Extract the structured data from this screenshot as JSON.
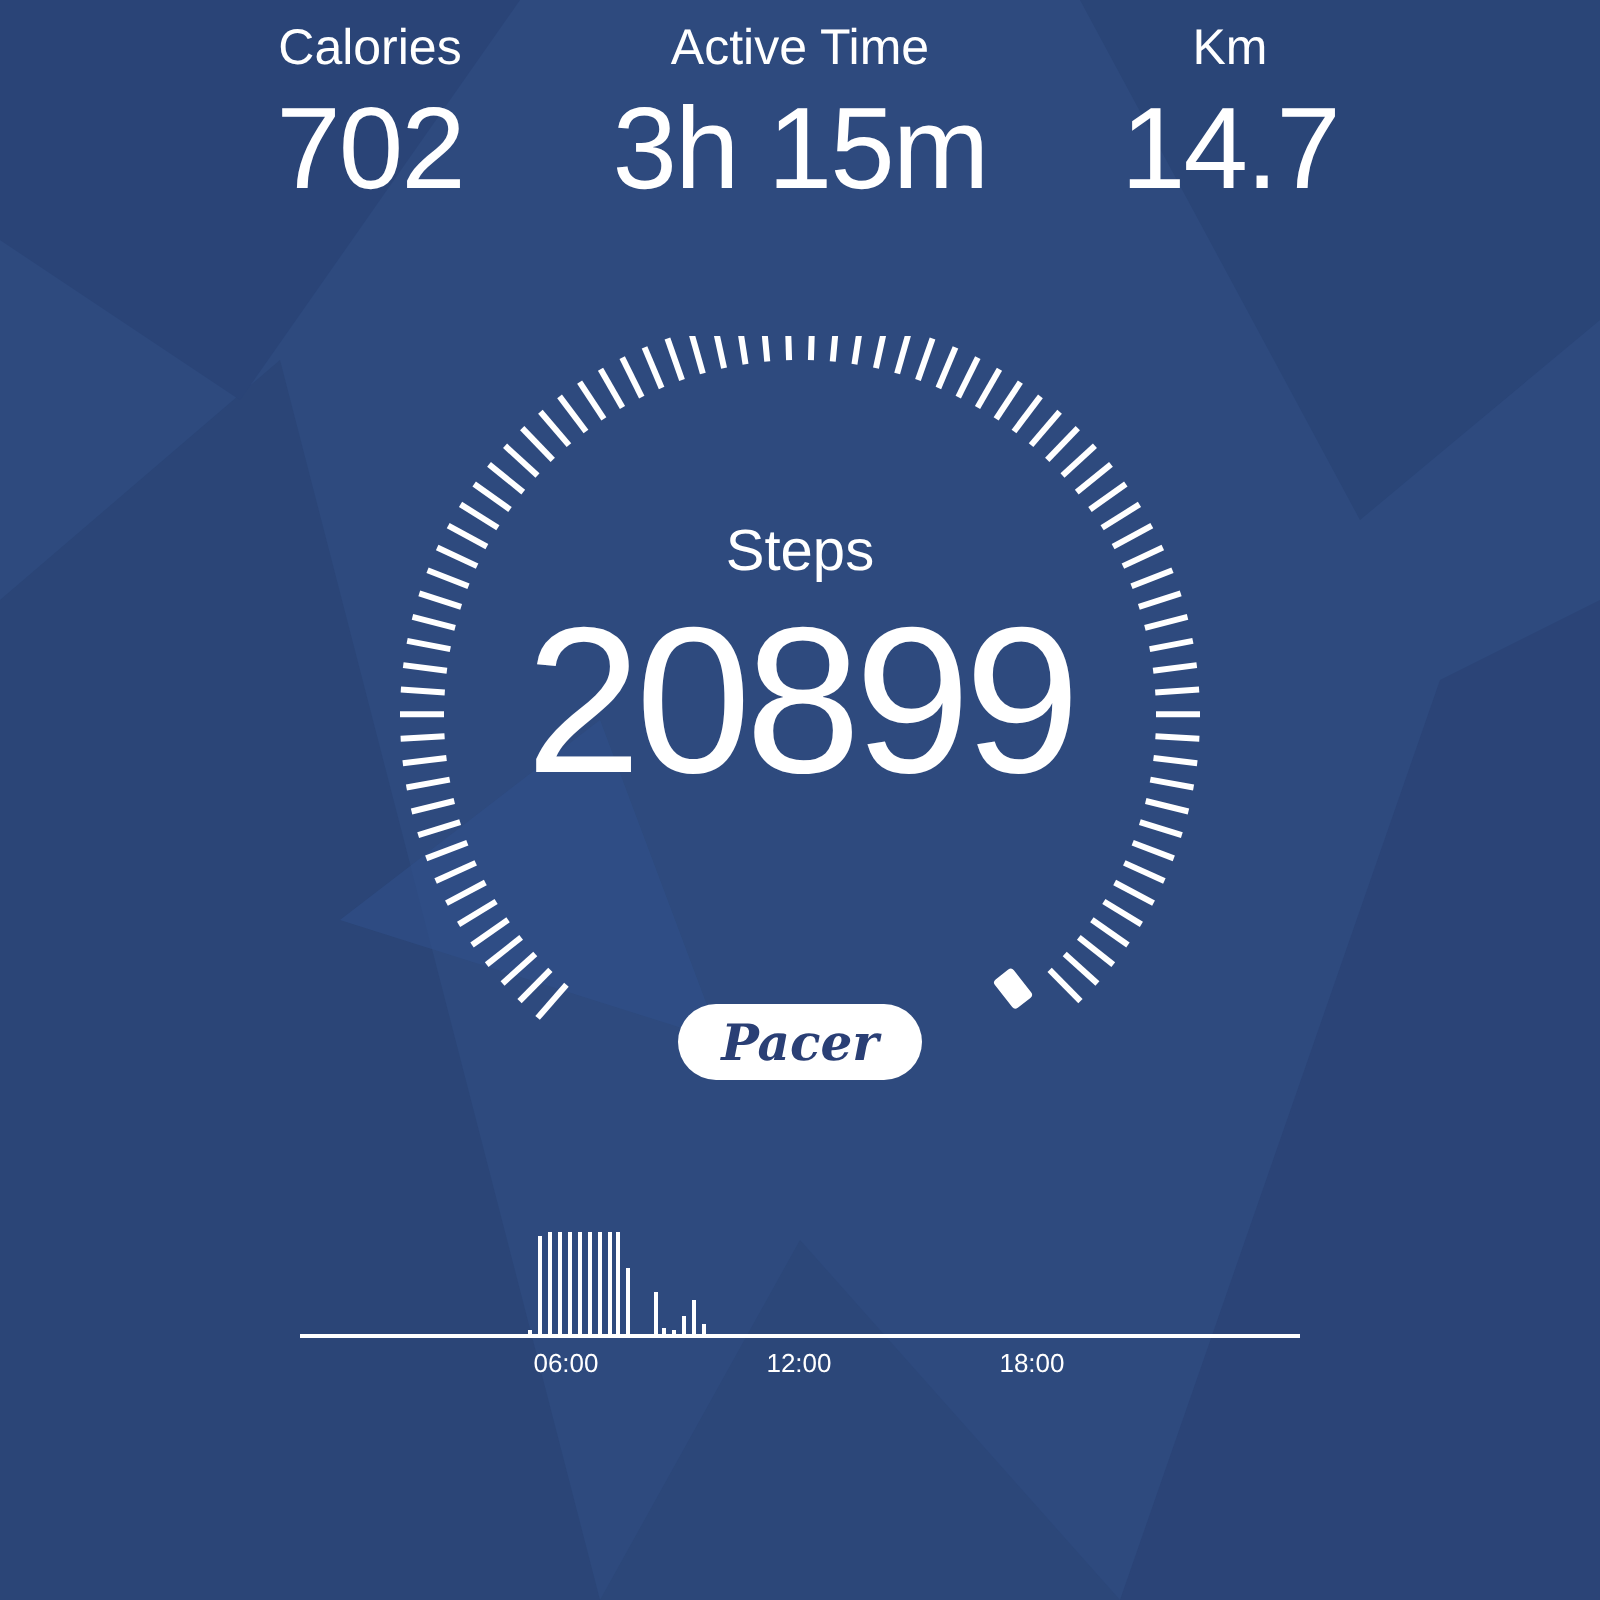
{
  "stats": [
    {
      "label": "Calories",
      "value": "702"
    },
    {
      "label": "Active Time",
      "value": "3h 15m"
    },
    {
      "label": "Km",
      "value": "14.7"
    }
  ],
  "gauge": {
    "label": "Steps",
    "value": "20899"
  },
  "brand": "Pacer",
  "activity_chart": {
    "kind": "picture",
    "x_labels": [
      "06:00",
      "12:00",
      "18:00"
    ]
  }
}
